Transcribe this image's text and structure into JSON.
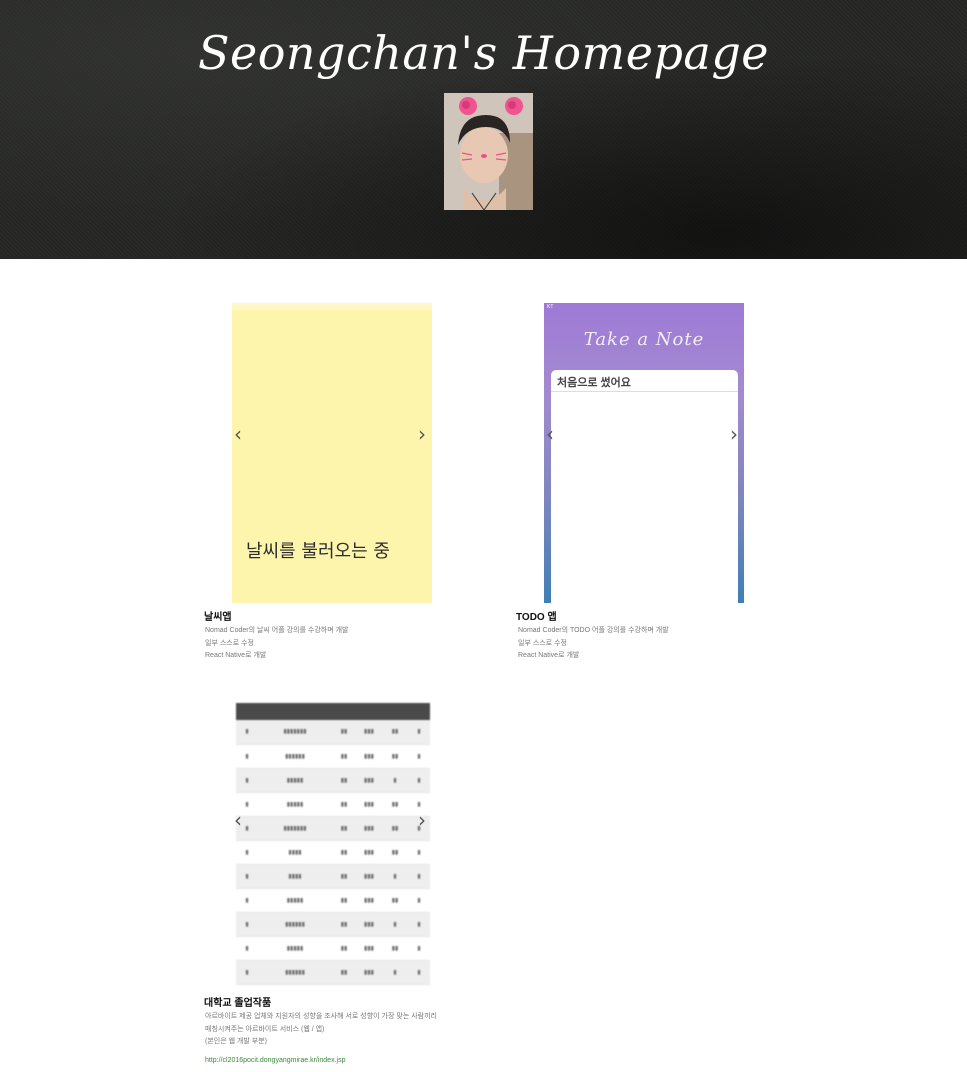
{
  "header": {
    "title": "Seongchan's Homepage"
  },
  "projects": [
    {
      "title": "날씨앱",
      "screen_text": "날씨를 불러오는 중",
      "desc": [
        "Nomad Coder의 날씨 어플 강의를 수강하며 개발",
        "일부 스스로 수정",
        "React Native로 개발"
      ]
    },
    {
      "title": "TODO 앱",
      "screen_title": "Take a Note",
      "screen_input": "처음으로 썼어요",
      "screen_status": "KT",
      "desc": [
        "Nomad Coder의 TODO 어플 강의를 수강하며 개발",
        "일부 스스로 수정",
        "React Native로 개발"
      ]
    },
    {
      "title": "대학교 졸업작품",
      "desc": [
        "아르바이트 제공 업체와 지원자의 성향을 조사해 서로 성향이 가장 맞는 사람끼리",
        "매칭시켜주는 아르바이트 서비스 (웹 / 앱)",
        "(본인은 웹 개발 부분)"
      ],
      "link": "http://cl2016pocit.dongyangmirae.kr/index.jsp"
    }
  ],
  "carousel": {
    "prev": "‹",
    "next": "›"
  },
  "icons": {
    "prev": "chevron-left-icon",
    "next": "chevron-right-icon"
  },
  "colors": {
    "weather_bg": "#fef5ac",
    "todo_gradient_top": "#9e7ad6",
    "todo_gradient_bottom": "#3f7fb5",
    "link": "#3a8a3a"
  }
}
